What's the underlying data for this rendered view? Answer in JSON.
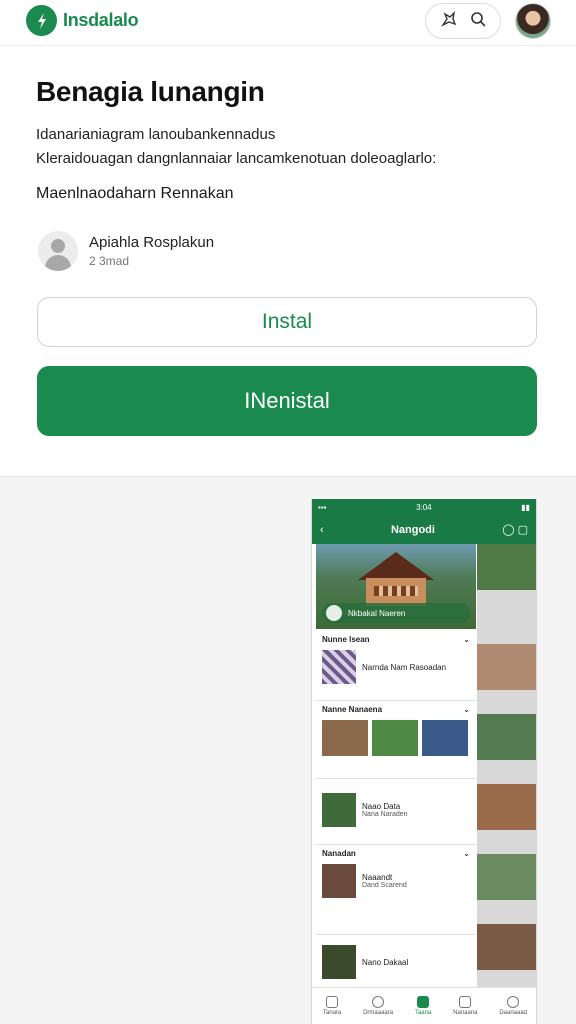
{
  "header": {
    "brand": "Insdalalo"
  },
  "content": {
    "title": "Benagia lunangin",
    "description_line1": "Idanarianiagram lanoubankennadus",
    "description_line2": "Kleraidouagan dangnlannaiar lancamkenotuan doleoaglarlo:",
    "subline": "Maenlnaodaharn Rennakan",
    "author_name": "Apiahla Rosplakun",
    "author_meta": "2 3mad"
  },
  "buttons": {
    "install_label": "Instal",
    "uninstall_label": "INenistal"
  },
  "preview": {
    "status_time": "3:04",
    "header_title": "Nangodi",
    "hero_caption": "Nkbakal Naeren",
    "section1_title": "Nunne lsean",
    "section1_item": "Narnda Nam Rasoadan",
    "section2_title": "Nanne Nanaena",
    "section3_item1": "Naao Data",
    "section3_item2": "Nana Naraden",
    "section4_title": "Nanadan",
    "section4_item1": "Naaandt",
    "section4_item2": "Dand Scarend",
    "section5_item": "Nano Dakaal",
    "nav": [
      "Tanara",
      "Drmaaaara",
      "Taana",
      "Nanaana",
      "Daanaaad"
    ]
  }
}
